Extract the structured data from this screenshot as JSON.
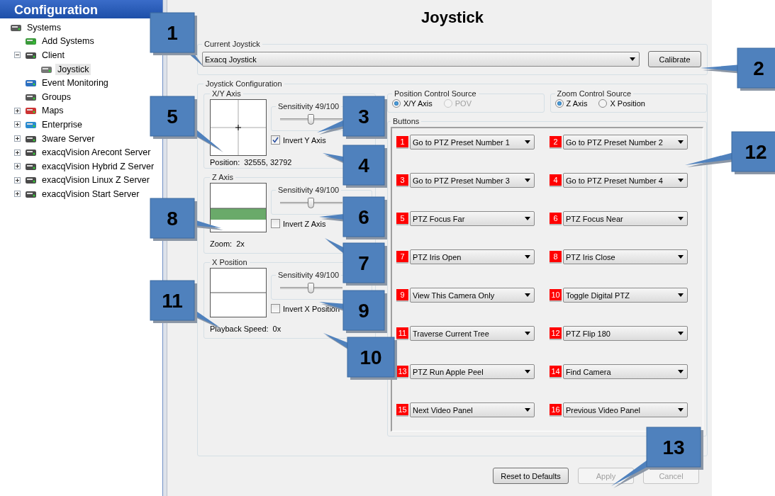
{
  "sidebar": {
    "title": "Configuration",
    "tree": [
      {
        "label": "Systems",
        "selected": false,
        "children": [
          {
            "label": "Add Systems",
            "selected": false
          },
          {
            "label": "Client",
            "selected": false,
            "expanded": true,
            "children": [
              {
                "label": "Joystick",
                "selected": true
              }
            ]
          },
          {
            "label": "Event Monitoring",
            "selected": false
          },
          {
            "label": "Groups",
            "selected": false
          },
          {
            "label": "Maps",
            "selected": false,
            "expanded": false
          },
          {
            "label": "Enterprise",
            "selected": false,
            "expanded": false
          },
          {
            "label": "3ware Server",
            "selected": false,
            "expanded": false
          },
          {
            "label": "exacqVision Arecont Server",
            "selected": false,
            "expanded": false
          },
          {
            "label": "exacqVision Hybrid Z Server",
            "selected": false,
            "expanded": false
          },
          {
            "label": "exacqVision Linux Z Server",
            "selected": false,
            "expanded": false
          },
          {
            "label": "exacqVision Start Server",
            "selected": false,
            "expanded": false
          }
        ]
      }
    ]
  },
  "main": {
    "title": "Joystick",
    "current_joystick": {
      "label": "Current Joystick",
      "value": "Exacq Joystick",
      "calibrate_button": "Calibrate"
    },
    "joystick_configuration": {
      "label": "Joystick Configuration",
      "axes": [
        {
          "kind": "crosshair",
          "label": "X/Y Axis",
          "sensitivity": "Sensitivity 49/100",
          "level": 0.49,
          "invert": {
            "label": "Invert Y Axis",
            "checked": true
          },
          "readout_label": "Position:",
          "readout_value": "32555, 32792"
        },
        {
          "kind": "zoom",
          "label": "Z Axis",
          "sensitivity": "Sensitivity 49/100",
          "level": 0.49,
          "invert": {
            "label": "Invert Z Axis",
            "checked": false
          },
          "readout_label": "Zoom:",
          "readout_value": "2x"
        },
        {
          "kind": "split",
          "label": "X Position",
          "sensitivity": "Sensitivity 49/100",
          "level": 0.49,
          "invert": {
            "label": "Invert X Position",
            "checked": false
          },
          "readout_label": "Playback Speed:",
          "readout_value": "0x"
        }
      ],
      "position_control_source": {
        "label": "Position Control Source",
        "options": [
          {
            "label": "X/Y Axis",
            "selected": true,
            "disabled": false
          },
          {
            "label": "POV",
            "selected": false,
            "disabled": true
          }
        ]
      },
      "zoom_control_source": {
        "label": "Zoom Control Source",
        "options": [
          {
            "label": "Z Axis",
            "selected": true,
            "disabled": false
          },
          {
            "label": "X Position",
            "selected": false,
            "disabled": false
          }
        ]
      },
      "buttons": {
        "label": "Buttons",
        "items": [
          {
            "number": "1",
            "action": "Go to PTZ Preset Number 1"
          },
          {
            "number": "2",
            "action": "Go to PTZ Preset Number 2"
          },
          {
            "number": "3",
            "action": "Go to PTZ Preset Number 3"
          },
          {
            "number": "4",
            "action": "Go to PTZ Preset Number 4"
          },
          {
            "number": "5",
            "action": "PTZ Focus Far"
          },
          {
            "number": "6",
            "action": "PTZ Focus Near"
          },
          {
            "number": "7",
            "action": "PTZ Iris Open"
          },
          {
            "number": "8",
            "action": "PTZ Iris Close"
          },
          {
            "number": "9",
            "action": "View This Camera Only"
          },
          {
            "number": "10",
            "action": "Toggle Digital PTZ"
          },
          {
            "number": "11",
            "action": "Traverse Current Tree"
          },
          {
            "number": "12",
            "action": "PTZ Flip 180"
          },
          {
            "number": "13",
            "action": "PTZ Run Apple Peel"
          },
          {
            "number": "14",
            "action": "Find Camera"
          },
          {
            "number": "15",
            "action": "Next Video Panel"
          },
          {
            "number": "16",
            "action": "Previous Video Panel"
          }
        ]
      }
    },
    "footer_buttons": [
      {
        "label": "Reset to Defaults",
        "disabled": false
      },
      {
        "label": "Apply",
        "disabled": true
      },
      {
        "label": "Cancel",
        "disabled": true
      }
    ]
  },
  "callouts": [
    "1",
    "2",
    "3",
    "4",
    "5",
    "6",
    "7",
    "8",
    "9",
    "10",
    "11",
    "12",
    "13"
  ]
}
